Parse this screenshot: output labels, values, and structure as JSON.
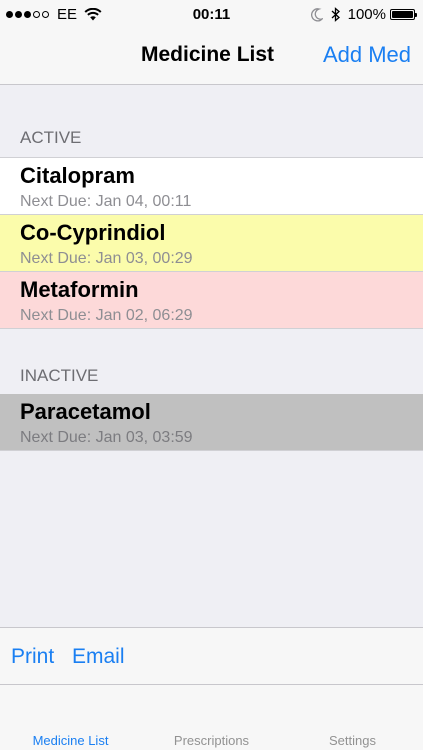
{
  "status_bar": {
    "signal_bars_filled": 3,
    "signal_bars_total": 5,
    "carrier": "EE",
    "time": "00:11",
    "battery_percent": "100%",
    "battery_level": 1.0,
    "icons": [
      "signal-dots-icon",
      "wifi-icon",
      "moon-icon",
      "bluetooth-icon",
      "battery-icon"
    ]
  },
  "nav": {
    "title": "Medicine List",
    "add_label": "Add Med"
  },
  "sections": {
    "active": {
      "header": "ACTIVE",
      "items": [
        {
          "name": "Citalopram",
          "due": "Next Due: Jan 04, 00:11",
          "bg": "#ffffff"
        },
        {
          "name": "Co-Cyprindiol",
          "due": "Next Due: Jan 03, 00:29",
          "bg": "#fbfcab"
        },
        {
          "name": "Metaformin",
          "due": "Next Due: Jan 02, 06:29",
          "bg": "#fdd9d9"
        }
      ]
    },
    "inactive": {
      "header": "INACTIVE",
      "items": [
        {
          "name": "Paracetamol",
          "due": "Next Due: Jan 03, 03:59",
          "bg": "#c0c0c0"
        }
      ]
    }
  },
  "toolbar": {
    "print_label": "Print",
    "email_label": "Email"
  },
  "tabs": [
    {
      "label": "Medicine List",
      "selected": true
    },
    {
      "label": "Prescriptions",
      "selected": false
    },
    {
      "label": "Settings",
      "selected": false
    }
  ],
  "colors": {
    "accent": "#1a7ff2",
    "tab_inactive": "#929292",
    "due_text": "#8e8e93",
    "due_text_inactive": "#7c7c80"
  }
}
